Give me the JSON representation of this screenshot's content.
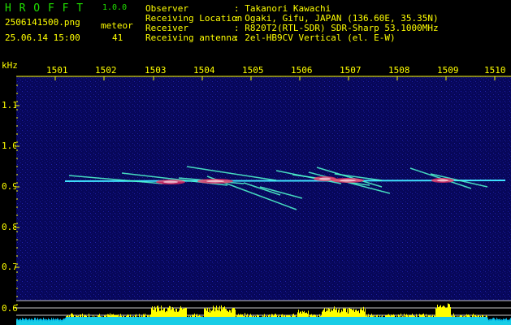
{
  "app": {
    "name": "H R O F F T",
    "version": "1.0.0",
    "filename": "2506141500.png",
    "datetime": "25.06.14 15:00",
    "meteor_label": "meteor",
    "meteor_count": "41"
  },
  "header": {
    "observer_key": "Observer",
    "observer_val": ": Takanori Kawachi",
    "location_key": "Receiving Location",
    "location_val": ": Ogaki, Gifu, JAPAN (136.60E, 35.35N)",
    "receiver_key": "Receiver",
    "receiver_val": ": R820T2(RTL-SDR) SDR-Sharp 53.1000MHz",
    "antenna_key": "Receiving antenna",
    "antenna_val": ": 2el-HB9CV Vertical (el. E-W)"
  },
  "axes": {
    "y_unit": "kHz",
    "x_ticks": [
      "1501",
      "1502",
      "1503",
      "1504",
      "1505",
      "1506",
      "1507",
      "1508",
      "1509",
      "1510"
    ],
    "y_ticks": [
      "1.1",
      "1.0",
      "0.9",
      "0.8",
      "0.7",
      "0.6"
    ]
  },
  "colors": {
    "background": "#000000",
    "spectrogram_bg": "#0a0a5a",
    "trace": "#40e0ff",
    "hot": "#ff3060",
    "label_yellow": "#ffff00",
    "title_green": "#20e000",
    "level_yellow": "#ffff00",
    "level_cyan": "#00c8ff"
  }
}
